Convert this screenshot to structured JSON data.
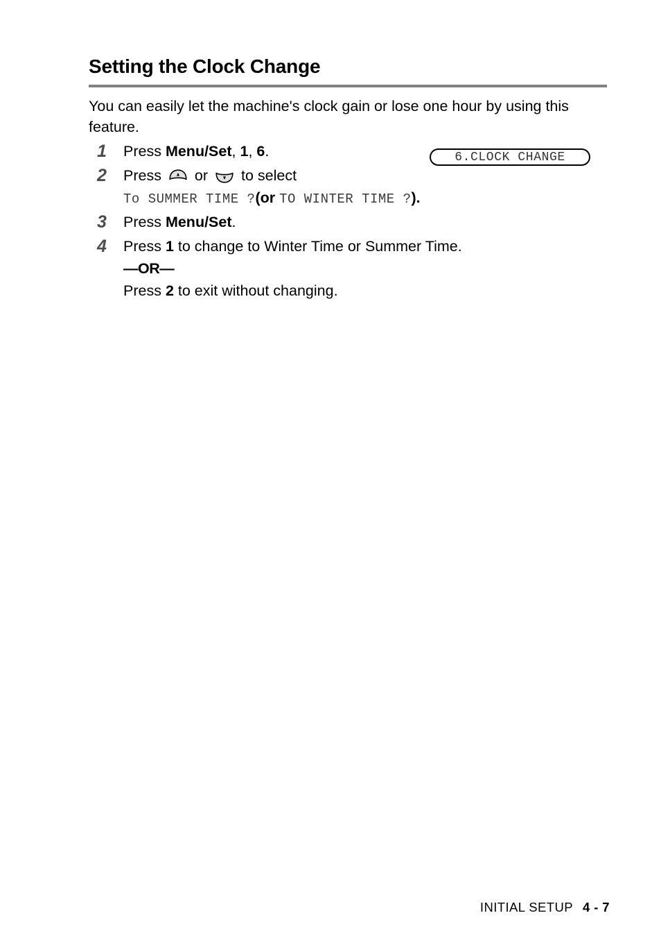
{
  "page": {
    "section_title": "Setting the Clock Change",
    "intro": "You can easily let the machine's clock gain or lose one hour by using this feature."
  },
  "lcd": {
    "display_text": "6.CLOCK CHANGE"
  },
  "steps": [
    {
      "number": "1",
      "prefix": "Press ",
      "bold1": "Menu/Set",
      "sep1": ", ",
      "bold2": "1",
      "sep2": ", ",
      "bold3": "6",
      "suffix": "."
    },
    {
      "number": "2",
      "prefix": "Press ",
      "middle": " or ",
      "suffix": " to select",
      "lcd_summer": "To SUMMER TIME ?",
      "or_word": "(or ",
      "lcd_winter": "TO WINTER TIME ?",
      "closing": ")."
    },
    {
      "number": "3",
      "prefix": "Press ",
      "bold1": "Menu/Set",
      "suffix": "."
    },
    {
      "number": "4",
      "prefix": "Press ",
      "bold1": "1",
      "suffix": " to change to Winter Time or Summer Time.",
      "or_divider": "—OR—",
      "alt_prefix": "Press ",
      "alt_bold": "2",
      "alt_suffix": " to exit without changing."
    }
  ],
  "footer": {
    "label": "INITIAL SETUP",
    "page_number": "4 - 7"
  },
  "icons": {
    "up_key": "up-arrow-key-icon",
    "down_key": "down-arrow-key-icon"
  },
  "colors": {
    "rule": "#808080",
    "step_number": "#4d4d4d",
    "lcd_text": "#333333",
    "text": "#000000"
  }
}
